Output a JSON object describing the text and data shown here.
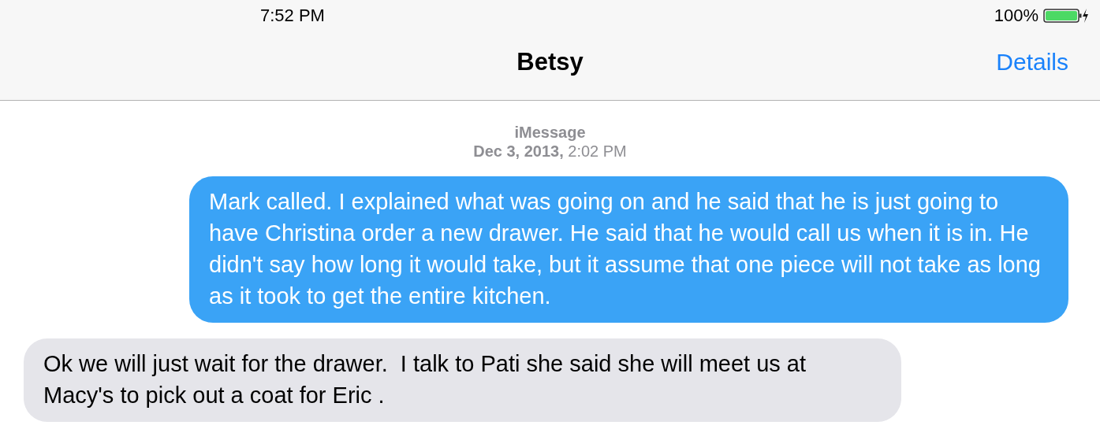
{
  "status_bar": {
    "time": "7:52 PM",
    "battery_text": "100%",
    "battery": {
      "level": 1,
      "charging": true
    }
  },
  "nav_bar": {
    "title": "Betsy",
    "action": "Details"
  },
  "thread_header": {
    "service": "iMessage",
    "timestamp": "**Dec 3, 2013,** 2:02 PM"
  },
  "messages": [
    {
      "kind": "sent",
      "text": "Mark called. I explained what was going on and he said that he is just going to have Christina order a new drawer. He said that he would call us when it is in. He didn't say how long it would take, but it assume that one piece will not take as long as it took to get the entire kitchen."
    },
    {
      "kind": "received",
      "text": "Ok we will just wait for the drawer.  I talk to Pati she said she will meet us at Macy's to pick out a coat for Eric ."
    }
  ]
}
